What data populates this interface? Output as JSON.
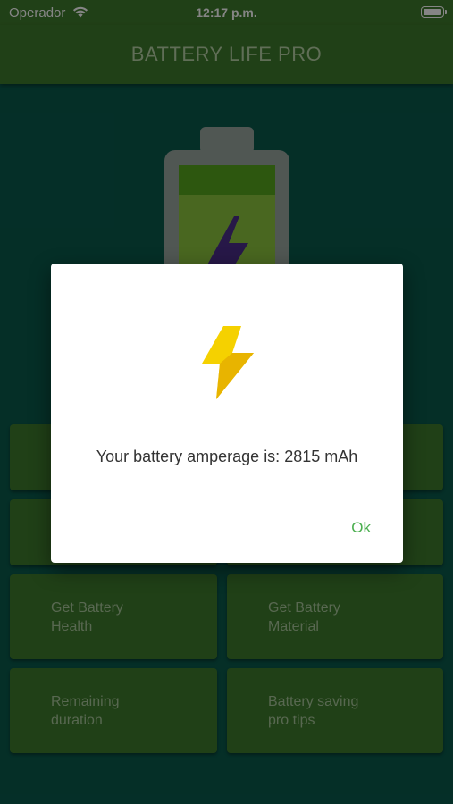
{
  "status_bar": {
    "carrier": "Operador",
    "time": "12:17 p.m."
  },
  "app_bar": {
    "title": "BATTERY LIFE PRO"
  },
  "menu": {
    "get_battery_health": "Get Battery\nHealth",
    "get_battery_material": "Get Battery\nMaterial",
    "remaining_duration": "Remaining\nduration",
    "battery_saving_tips": "Battery saving\npro tips"
  },
  "dialog": {
    "message": "Your battery amperage is: 2815 mAh",
    "ok_label": "Ok"
  },
  "colors": {
    "app_bar": "#3f7b2c",
    "background": "#0a5a4c",
    "accent_ok": "#4caf50",
    "bolt": "#f5d100"
  },
  "icons": {
    "status_wifi": "wifi-icon",
    "status_battery": "battery-icon",
    "hero": "battery-charging-icon",
    "dialog": "lightning-bolt-icon"
  }
}
